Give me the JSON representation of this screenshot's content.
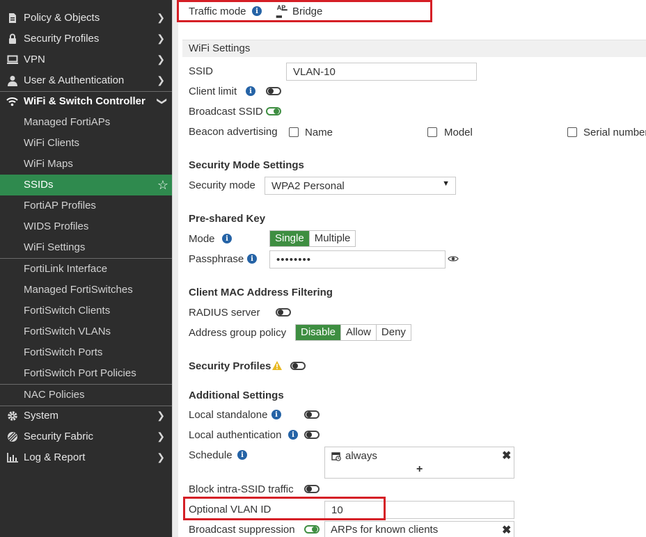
{
  "sidebar": {
    "top_items": [
      {
        "label": "Policy & Objects",
        "icon": "policy-icon"
      },
      {
        "label": "Security Profiles",
        "icon": "lock-icon"
      },
      {
        "label": "VPN",
        "icon": "monitor-icon"
      },
      {
        "label": "User & Authentication",
        "icon": "user-icon"
      }
    ],
    "wifi_section": {
      "label": "WiFi & Switch Controller",
      "icon": "wifi-icon"
    },
    "wifi_items": [
      "Managed FortiAPs",
      "WiFi Clients",
      "WiFi Maps",
      "SSIDs",
      "FortiAP Profiles",
      "WIDS Profiles",
      "WiFi Settings"
    ],
    "switch_items": [
      "FortiLink Interface",
      "Managed FortiSwitches",
      "FortiSwitch Clients",
      "FortiSwitch VLANs",
      "FortiSwitch Ports",
      "FortiSwitch Port Policies"
    ],
    "nac_items": [
      "NAC Policies"
    ],
    "bottom_items": [
      {
        "label": "System",
        "icon": "gear-icon"
      },
      {
        "label": "Security Fabric",
        "icon": "fabric-icon"
      },
      {
        "label": "Log & Report",
        "icon": "chart-icon"
      }
    ],
    "active_item": "SSIDs",
    "accent_color": "#2f8a4e"
  },
  "traffic_mode": {
    "label": "Traffic mode",
    "value_badge": "AP",
    "value": "Bridge"
  },
  "wifi_settings": {
    "title": "WiFi Settings",
    "ssid_label": "SSID",
    "ssid_value": "VLAN-10",
    "client_limit_label": "Client limit",
    "client_limit_on": false,
    "broadcast_ssid_label": "Broadcast SSID",
    "broadcast_ssid_on": true,
    "beacon_label": "Beacon advertising",
    "beacon_options": [
      "Name",
      "Model",
      "Serial number"
    ]
  },
  "security_mode": {
    "title": "Security Mode Settings",
    "label": "Security mode",
    "value": "WPA2 Personal"
  },
  "psk": {
    "title": "Pre-shared Key",
    "mode_label": "Mode",
    "mode_options": [
      "Single",
      "Multiple"
    ],
    "mode_selected": "Single",
    "passphrase_label": "Passphrase",
    "passphrase_value": "••••••••"
  },
  "mac_filter": {
    "title": "Client MAC Address Filtering",
    "radius_label": "RADIUS server",
    "radius_on": false,
    "addr_group_label": "Address group policy",
    "addr_group_options": [
      "Disable",
      "Allow",
      "Deny"
    ],
    "addr_group_selected": "Disable"
  },
  "security_profiles": {
    "label": "Security Profiles",
    "on": false
  },
  "additional": {
    "title": "Additional Settings",
    "local_standalone_label": "Local standalone",
    "local_auth_label": "Local authentication",
    "schedule_label": "Schedule",
    "schedule_value": "always",
    "schedule_add": "+",
    "block_intra_label": "Block intra-SSID traffic",
    "vlan_label": "Optional VLAN ID",
    "vlan_value": "10",
    "broadcast_supp_label": "Broadcast suppression",
    "broadcast_supp_on": true,
    "broadcast_supp_value": "ARPs for known clients"
  },
  "colors": {
    "accent_green": "#3e8e41",
    "highlight_red": "#d51f26",
    "info_blue": "#2563a6"
  }
}
